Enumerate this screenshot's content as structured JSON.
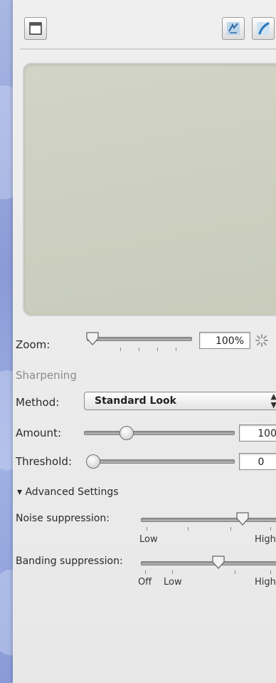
{
  "toolbar": {
    "left_icon": "window-icon",
    "right_icons": [
      "compare-icon",
      "brush-icon"
    ]
  },
  "zoom": {
    "label": "Zoom:",
    "value": "100%",
    "level_percent": 100,
    "slider_fraction": 0.0
  },
  "sharpening": {
    "section_title": "Sharpening",
    "method_label": "Method:",
    "method_value": "Standard Look",
    "amount_label": "Amount:",
    "amount_value": "100",
    "amount_fraction": 0.28,
    "threshold_label": "Threshold:",
    "threshold_value": "0",
    "threshold_fraction": 0.0
  },
  "advanced": {
    "toggle_label": "▾ Advanced Settings",
    "noise_label": "Noise suppression:",
    "noise_fraction": 0.72,
    "noise_low": "Low",
    "noise_high": "High",
    "banding_label": "Banding suppression:",
    "banding_fraction": 0.55,
    "banding_off": "Off",
    "banding_low": "Low",
    "banding_high": "High"
  },
  "colors": {
    "panel": "#ececec",
    "preview": "#cdd0c0",
    "background": "#8e9fd9"
  }
}
